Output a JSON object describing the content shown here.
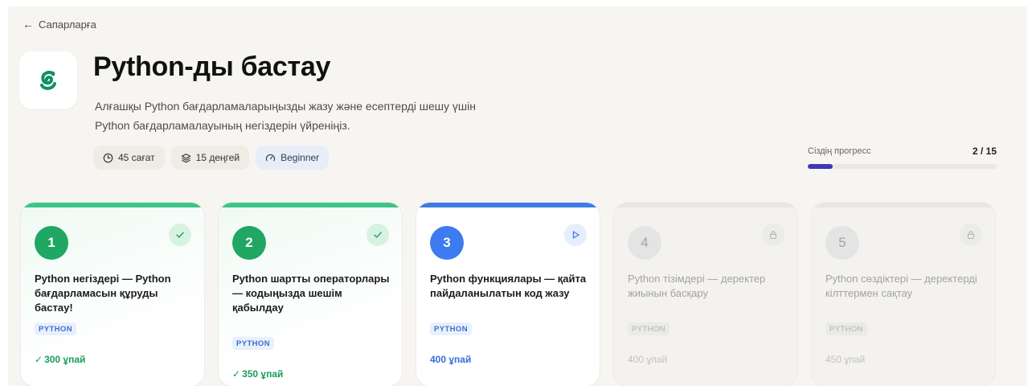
{
  "nav": {
    "back_label": "Сапарларға",
    "back_icon": "arrow-left-icon"
  },
  "course": {
    "icon": "python-snake-icon",
    "title": "Python-ды бастау",
    "description_line1": "Алғашқы Python бағдарламаларыңызды жазу және есептерді шешу үшін",
    "description_line2": "Python бағдарламалауының негіздерін үйреніңіз.",
    "meta": {
      "duration": "45 сағат",
      "levels": "15 деңгей",
      "difficulty": "Beginner"
    }
  },
  "progress": {
    "label": "Сіздің прогресс",
    "count": "2 / 15",
    "completed": 2,
    "total": 15
  },
  "colors": {
    "done": "#1fa763",
    "active": "#3c7cf0",
    "progress_fill": "#3f36b8"
  },
  "cards": [
    {
      "number": "1",
      "status": "done",
      "title": "Python негіздері — Python бағдарламасын құруды бастау!",
      "tag": "PYTHON",
      "points": "300 ұпай"
    },
    {
      "number": "2",
      "status": "done",
      "title": "Python шартты операторлары — кодыңызда шешім қабылдау",
      "tag": "PYTHON",
      "points": "350 ұпай"
    },
    {
      "number": "3",
      "status": "active",
      "title": "Python функциялары — қайта пайдаланылатын код жазу",
      "tag": "PYTHON",
      "points": "400 ұпай"
    },
    {
      "number": "4",
      "status": "locked",
      "title": "Python тізімдері — деректер жиынын басқару",
      "tag": "PYTHON",
      "points": "400 ұпай"
    },
    {
      "number": "5",
      "status": "locked",
      "title": "Python сөздіктері — деректерді кілттермен сақтау",
      "tag": "PYTHON",
      "points": "450 ұпай"
    }
  ]
}
